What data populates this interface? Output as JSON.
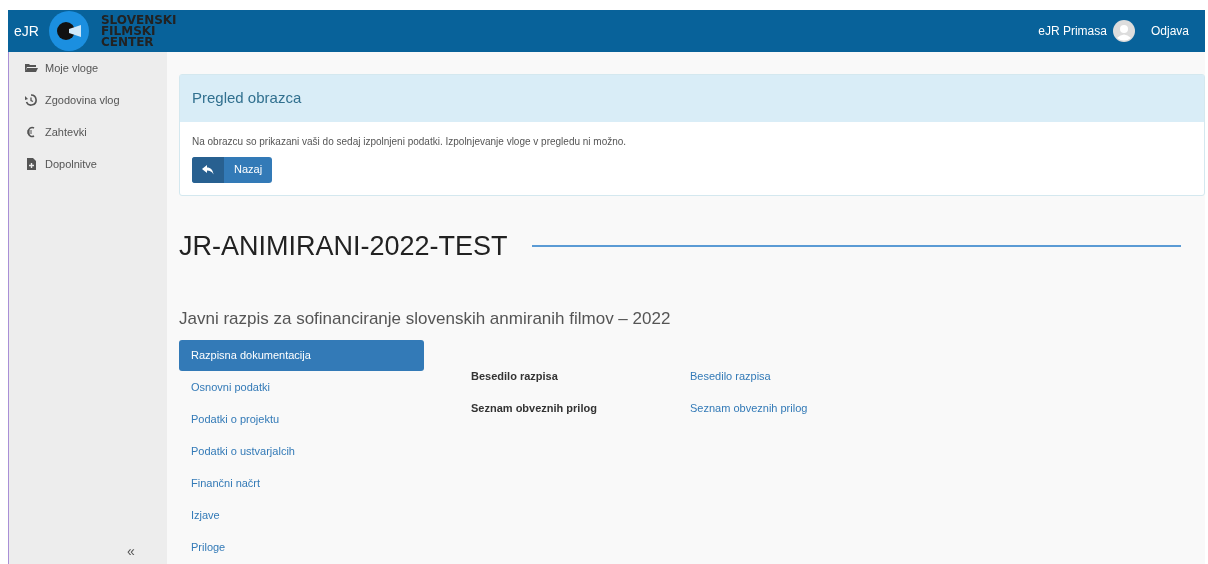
{
  "header": {
    "app_name": "eJR",
    "logo_text": [
      "SLOVENSKI",
      "FILMSKI",
      "CENTER"
    ],
    "user": "eJR Primasa",
    "logout": "Odjava"
  },
  "sidebar": {
    "items": [
      {
        "kind": "folder",
        "label": "Moje vloge"
      },
      {
        "kind": "history",
        "label": "Zgodovina vlog"
      },
      {
        "kind": "euro",
        "label": "Zahtevki"
      },
      {
        "kind": "file",
        "label": "Dopolnitve"
      }
    ],
    "collapse": "«"
  },
  "notice": {
    "title": "Pregled obrazca",
    "text": "Na obrazcu so prikazani vaši do sedaj izpolnjeni podatki. Izpolnjevanje vloge v pregledu ni možno.",
    "button": "Nazaj"
  },
  "heading": "JR-ANIMIRANI-2022-TEST",
  "subtitle": "Javni razpis za sofinanciranje slovenskih anmiranih filmov – 2022",
  "tabs": [
    {
      "label": "Razpisna dokumentacija",
      "selected": true
    },
    {
      "label": "Osnovni podatki",
      "selected": false
    },
    {
      "label": "Podatki o projektu",
      "selected": false
    },
    {
      "label": "Podatki o ustvarjalcih",
      "selected": false
    },
    {
      "label": "Finančni načrt",
      "selected": false
    },
    {
      "label": "Izjave",
      "selected": false
    },
    {
      "label": "Priloge",
      "selected": false
    }
  ],
  "documents": [
    {
      "label": "Besedilo razpisa",
      "link": "Besedilo razpisa"
    },
    {
      "label": "Seznam obveznih prilog",
      "link": "Seznam obveznih prilog"
    }
  ]
}
